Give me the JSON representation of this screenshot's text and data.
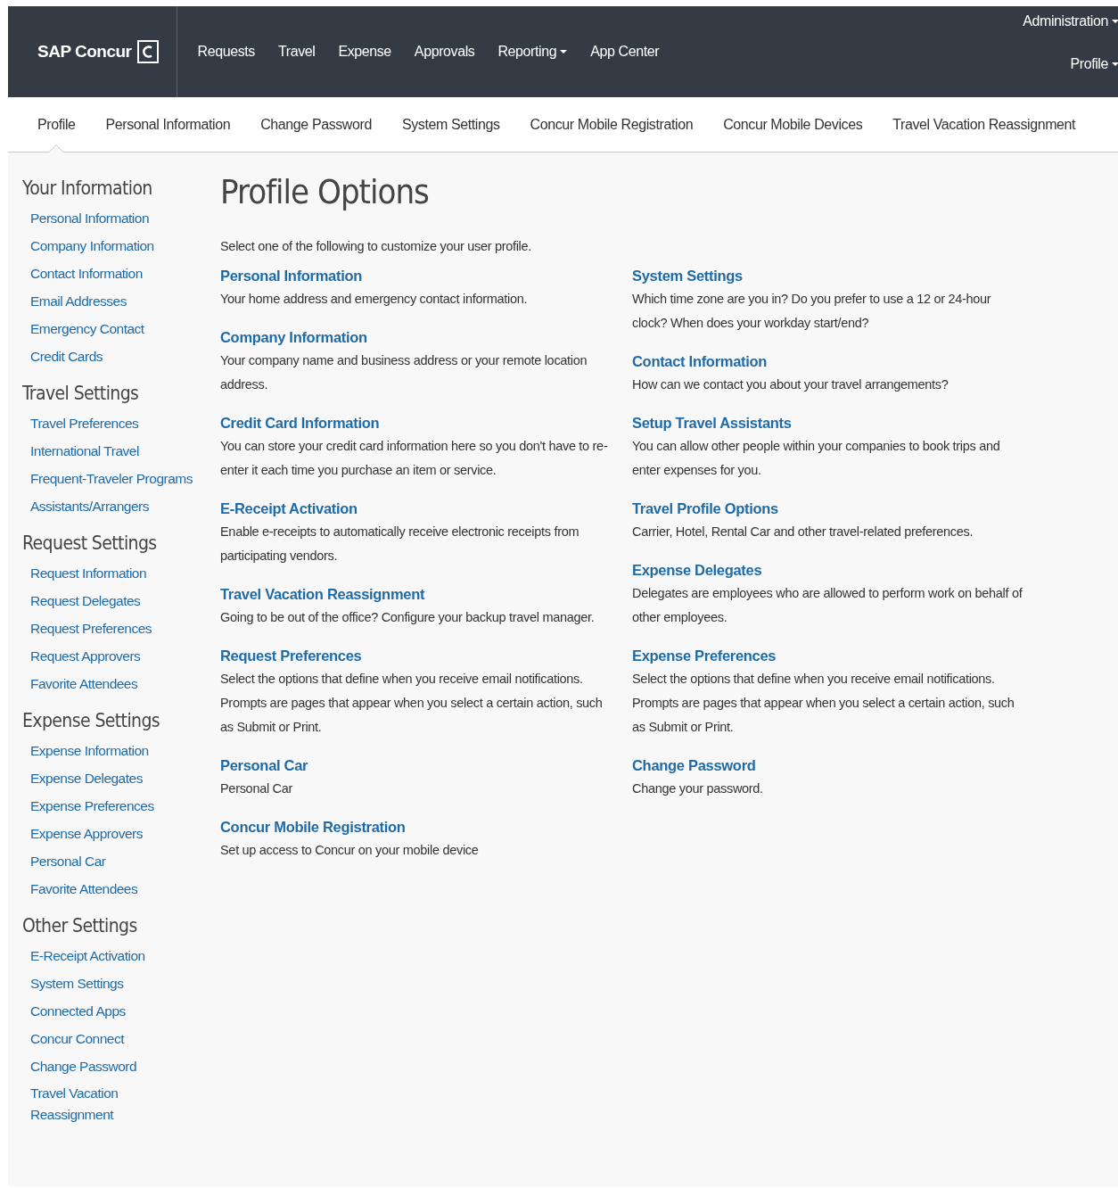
{
  "header": {
    "logo": "SAP Concur",
    "nav": [
      {
        "label": "Requests",
        "has_menu": false
      },
      {
        "label": "Travel",
        "has_menu": false
      },
      {
        "label": "Expense",
        "has_menu": false
      },
      {
        "label": "Approvals",
        "has_menu": false
      },
      {
        "label": "Reporting",
        "has_menu": true
      },
      {
        "label": "App Center",
        "has_menu": false
      }
    ],
    "utility": [
      {
        "label": "Administration",
        "has_menu": true
      },
      {
        "label": "Profile",
        "has_menu": true
      }
    ]
  },
  "tabs": [
    {
      "label": "Profile",
      "selected": true
    },
    {
      "label": "Personal Information",
      "selected": false
    },
    {
      "label": "Change Password",
      "selected": false
    },
    {
      "label": "System Settings",
      "selected": false
    },
    {
      "label": "Concur Mobile Registration",
      "selected": false
    },
    {
      "label": "Concur Mobile Devices",
      "selected": false
    },
    {
      "label": "Travel Vacation Reassignment",
      "selected": false
    }
  ],
  "sidebar": {
    "sections": [
      {
        "title": "Your Information",
        "items": [
          "Personal Information",
          "Company Information",
          "Contact Information",
          "Email Addresses",
          "Emergency Contact",
          "Credit Cards"
        ]
      },
      {
        "title": "Travel Settings",
        "items": [
          "Travel Preferences",
          "International Travel",
          "Frequent-Traveler Programs",
          "Assistants/Arrangers"
        ]
      },
      {
        "title": "Request Settings",
        "items": [
          "Request Information",
          "Request Delegates",
          "Request Preferences",
          "Request Approvers",
          "Favorite Attendees"
        ]
      },
      {
        "title": "Expense Settings",
        "items": [
          "Expense Information",
          "Expense Delegates",
          "Expense Preferences",
          "Expense Approvers",
          "Personal Car",
          "Favorite Attendees"
        ]
      },
      {
        "title": "Other Settings",
        "items": [
          "E-Receipt Activation",
          "System Settings",
          "Connected Apps",
          "Concur Connect",
          "Change Password",
          "Travel Vacation Reassignment"
        ]
      }
    ]
  },
  "content": {
    "title": "Profile Options",
    "intro": "Select one of the following to customize your user profile.",
    "columns": [
      [
        {
          "title": "Personal Information",
          "description": "Your home address and emergency contact information."
        },
        {
          "title": "Company Information",
          "description": "Your company name and business address or your remote location address."
        },
        {
          "title": "Credit Card Information",
          "description": "You can store your credit card information here so you don't have to re-enter it each time you purchase an item or service."
        },
        {
          "title": "E-Receipt Activation",
          "description": "Enable e-receipts to automatically receive electronic receipts from participating vendors."
        },
        {
          "title": "Travel Vacation Reassignment",
          "description": "Going to be out of the office? Configure your backup travel manager."
        },
        {
          "title": "Request Preferences",
          "description": "Select the options that define when you receive email notifications. Prompts are pages that appear when you select a certain action, such as Submit or Print."
        },
        {
          "title": "Personal Car",
          "description": "Personal Car"
        },
        {
          "title": "Concur Mobile Registration",
          "description": "Set up access to Concur on your mobile device"
        }
      ],
      [
        {
          "title": "System Settings",
          "description": "Which time zone are you in? Do you prefer to use a 12 or 24-hour clock? When does your workday start/end?"
        },
        {
          "title": "Contact Information",
          "description": "How can we contact you about your travel arrangements?"
        },
        {
          "title": "Setup Travel Assistants",
          "description": "You can allow other people within your companies to book trips and enter expenses for you."
        },
        {
          "title": "Travel Profile Options",
          "description": "Carrier, Hotel, Rental Car and other travel-related preferences."
        },
        {
          "title": "Expense Delegates",
          "description": "Delegates are employees who are allowed to perform work on behalf of other employees."
        },
        {
          "title": "Expense Preferences",
          "description": "Select the options that define when you receive email notifications. Prompts are pages that appear when you select a certain action, such as Submit or Print."
        },
        {
          "title": "Change Password",
          "description": "Change your password."
        }
      ]
    ]
  }
}
